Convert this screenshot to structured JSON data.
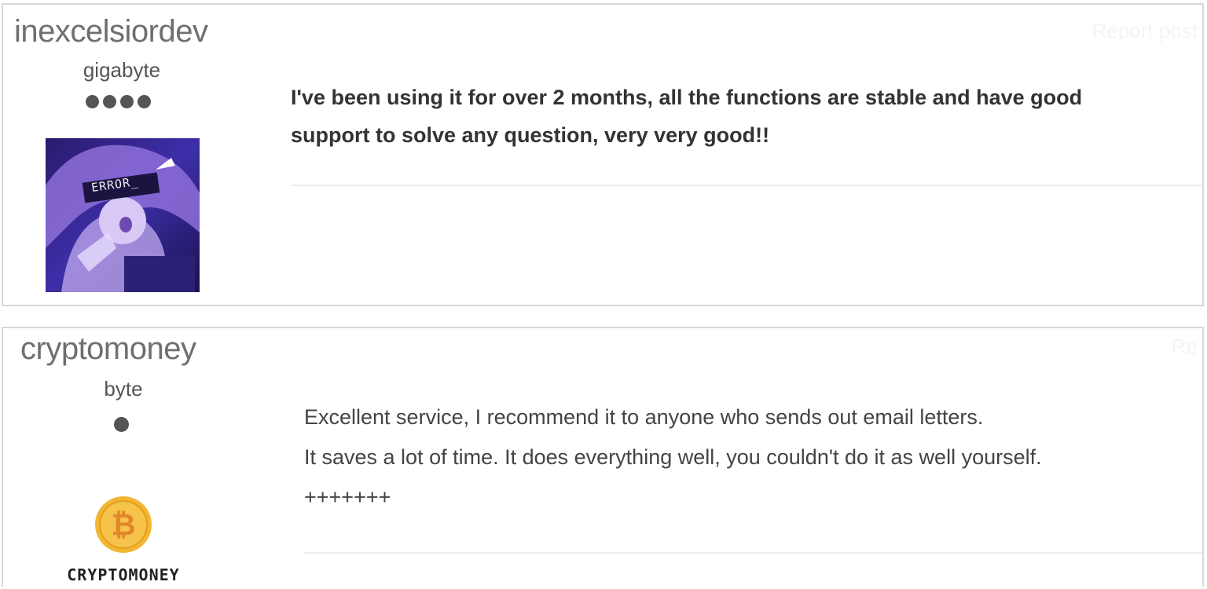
{
  "posts": [
    {
      "username": "inexcelsiordev",
      "rank": "gigabyte",
      "rank_dots": 4,
      "avatar": "error-anime-avatar",
      "avatar_text": "ERROR_",
      "report_label": "Report post",
      "message_lines": [
        "I've been using it for over 2 months, all the functions are stable and have good",
        "support to solve any question, very very good!!"
      ]
    },
    {
      "username": "cryptomoney",
      "rank": "byte",
      "rank_dots": 1,
      "avatar": "bitcoin-coin-logo",
      "avatar_text": "CRYPTOMONEY",
      "report_label": "Re",
      "message_lines": [
        "Excellent service, I recommend it to anyone who sends out email letters.",
        "It saves a lot of time. It does everything well, you couldn't do it as well yourself.",
        "+++++++"
      ]
    }
  ],
  "colors": {
    "border": "#d7d7d7",
    "username": "#6f6f6f",
    "text": "#333333",
    "coin": "#f2b632"
  }
}
